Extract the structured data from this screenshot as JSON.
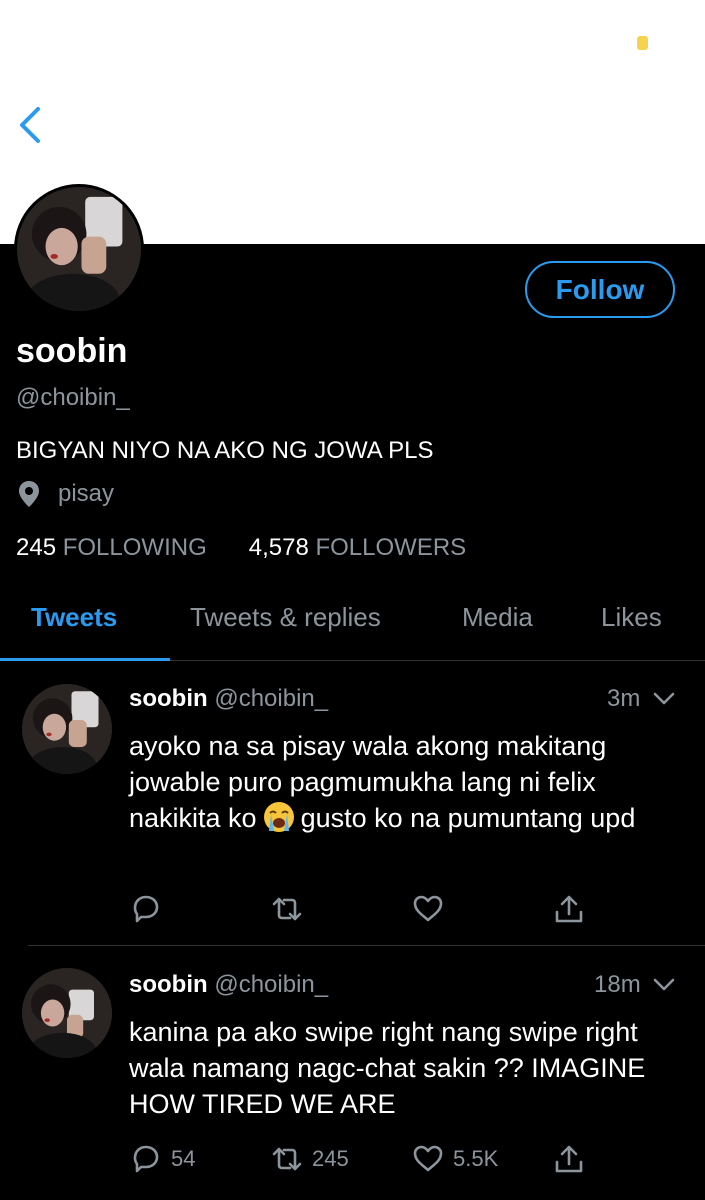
{
  "colors": {
    "accent": "#2b9bf0",
    "muted": "#8d959c",
    "background": "#000000"
  },
  "nav": {
    "back_icon": "chevron-left-icon"
  },
  "profile": {
    "name": "soobin",
    "handle": "@choibin_",
    "bio": "BIGYAN NIYO NA AKO NG JOWA PLS",
    "location": "pisay",
    "following_count": "245",
    "following_label": "FOLLOWING",
    "followers_count": "4,578",
    "followers_label": "FOLLOWERS",
    "follow_label": "Follow"
  },
  "tabs": [
    {
      "label": "Tweets",
      "active": true
    },
    {
      "label": "Tweets & replies"
    },
    {
      "label": "Media"
    },
    {
      "label": "Likes"
    }
  ],
  "tweets": [
    {
      "name": "soobin",
      "handle": "@choibin_",
      "time": "3m",
      "text_before_emoji": "ayoko na sa pisay wala akong makitang jowable puro pagmumukha lang ni felix nakikita ko",
      "emoji": "loudly-crying-face",
      "text_after_emoji": "gusto ko na pumuntang upd",
      "replies": "",
      "retweets": "",
      "likes": ""
    },
    {
      "name": "soobin",
      "handle": "@choibin_",
      "time": "18m",
      "text": "kanina pa ako swipe right nang swipe right wala namang nagc-chat sakin ?? IMAGINE HOW TIRED WE ARE",
      "replies": "54",
      "retweets": "245",
      "likes": "5.5K"
    }
  ]
}
